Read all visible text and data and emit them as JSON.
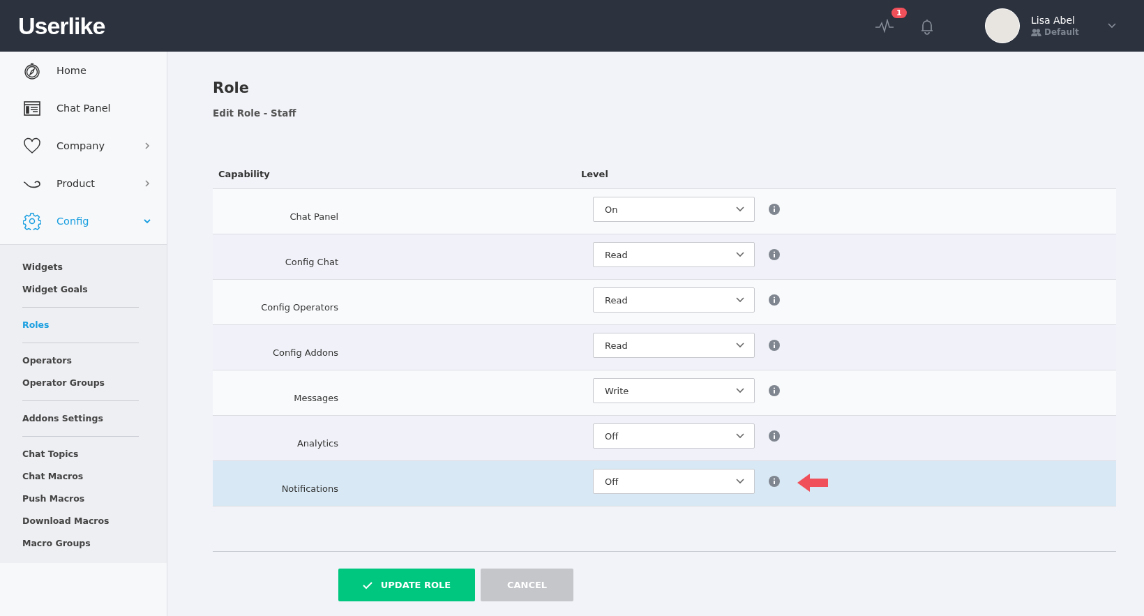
{
  "header": {
    "logo": "Userlike",
    "activity_badge": "1",
    "user": {
      "name": "Lisa Abel",
      "group": "Default"
    }
  },
  "sidebar": {
    "items": [
      {
        "label": "Home",
        "selected": false,
        "kind": "link"
      },
      {
        "label": "Chat Panel",
        "selected": false,
        "kind": "link"
      },
      {
        "label": "Company",
        "selected": false,
        "kind": "collapsed"
      },
      {
        "label": "Product",
        "selected": false,
        "kind": "collapsed"
      },
      {
        "label": "Config",
        "selected": true,
        "kind": "expanded"
      }
    ],
    "sub_groups": [
      [
        {
          "label": "Widgets",
          "selected": false
        },
        {
          "label": "Widget Goals",
          "selected": false
        }
      ],
      [
        {
          "label": "Roles",
          "selected": true
        }
      ],
      [
        {
          "label": "Operators",
          "selected": false
        },
        {
          "label": "Operator Groups",
          "selected": false
        }
      ],
      [
        {
          "label": "Addons Settings",
          "selected": false
        }
      ],
      [
        {
          "label": "Chat Topics",
          "selected": false
        },
        {
          "label": "Chat Macros",
          "selected": false
        },
        {
          "label": "Push Macros",
          "selected": false
        },
        {
          "label": "Download Macros",
          "selected": false
        },
        {
          "label": "Macro Groups",
          "selected": false
        }
      ]
    ]
  },
  "page": {
    "title": "Role",
    "subtitle": "Edit Role - Staff"
  },
  "table": {
    "columns": [
      "Capability",
      "Level"
    ],
    "rows": [
      {
        "capability": "Chat Panel",
        "level": "On",
        "highlighted": false
      },
      {
        "capability": "Config Chat",
        "level": "Read",
        "highlighted": false
      },
      {
        "capability": "Config Operators",
        "level": "Read",
        "highlighted": false
      },
      {
        "capability": "Config Addons",
        "level": "Read",
        "highlighted": false
      },
      {
        "capability": "Messages",
        "level": "Write",
        "highlighted": false
      },
      {
        "capability": "Analytics",
        "level": "Off",
        "highlighted": false
      },
      {
        "capability": "Notifications",
        "level": "Off",
        "highlighted": true
      }
    ]
  },
  "buttons": [
    {
      "label": "UPDATE ROLE",
      "kind": "primary"
    },
    {
      "label": "CANCEL",
      "kind": "secondary"
    }
  ]
}
